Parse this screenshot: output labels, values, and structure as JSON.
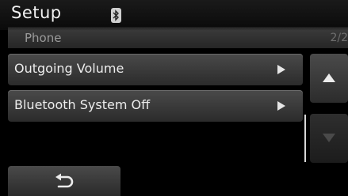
{
  "header": {
    "title": "Setup",
    "status_icon": "bluetooth-icon"
  },
  "subheader": {
    "title": "Phone",
    "page_indicator": "2/2"
  },
  "list": {
    "items": [
      {
        "label": "Outgoing Volume",
        "icon": "play-arrow-icon"
      },
      {
        "label": "Bluetooth System Off",
        "icon": "play-arrow-icon"
      }
    ]
  },
  "scroll": {
    "up_icon": "triangle-up-icon",
    "down_icon": "triangle-down-icon",
    "down_enabled": false
  },
  "footer": {
    "back_icon": "back-arrow-icon"
  },
  "colors": {
    "background": "#000000",
    "text": "#ededed",
    "button": "#3a3a3a"
  }
}
